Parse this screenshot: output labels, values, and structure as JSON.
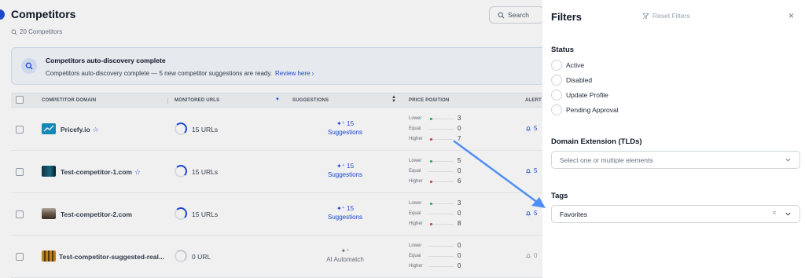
{
  "header": {
    "title": "Competitors",
    "count_text": "20 Competitors",
    "search_label": "Search"
  },
  "banner": {
    "title": "Competitors auto-discovery complete",
    "text": "Competitors auto-discovery complete — 5 new competitor suggestions are ready.",
    "link": "Review here ›"
  },
  "table": {
    "columns": [
      "COMPETITOR DOMAIN",
      "MONITORED URLS",
      "SUGGESTIONS",
      "PRICE POSITION",
      "ALERT"
    ],
    "price_labels": [
      "Lower",
      "Equal",
      "Higher"
    ],
    "rows": [
      {
        "domain": "Pricefy.io",
        "star": "☆",
        "urls": "15 URLs",
        "sugg_count": "15",
        "sugg_label": "Suggestions",
        "lower": "3",
        "equal": "0",
        "higher": "7",
        "alert": "5"
      },
      {
        "domain": "Test-competitor-1.com",
        "star": "☆",
        "urls": "15 URLs",
        "sugg_count": "15",
        "sugg_label": "Suggestions",
        "lower": "5",
        "equal": "0",
        "higher": "6",
        "alert": "5"
      },
      {
        "domain": "Test-competitor-2.com",
        "star": "",
        "urls": "15 URLs",
        "sugg_count": "15",
        "sugg_label": "Suggestions",
        "lower": "3",
        "equal": "0",
        "higher": "8",
        "alert": "5"
      },
      {
        "domain": "Test-competitor-suggested-real...",
        "star": "",
        "urls": "0 URL",
        "sugg_count": "",
        "sugg_label": "AI Automatch",
        "lower": "0",
        "equal": "0",
        "higher": "0",
        "alert": "0"
      }
    ]
  },
  "filters": {
    "title": "Filters",
    "reset_label": "Reset Filters",
    "close": "×",
    "status": {
      "title": "Status",
      "options": [
        "Active",
        "Disabled",
        "Update Profile",
        "Pending Approval"
      ]
    },
    "domain_ext": {
      "title": "Domain Extension (TLDs)",
      "placeholder": "Select one or multiple elements"
    },
    "tags": {
      "title": "Tags",
      "value": "Favorites",
      "clear": "×"
    }
  },
  "colors": {
    "accent": "#1d4ed8",
    "arrow": "#4f8ef7",
    "lower": "#22c55e",
    "higher": "#ef4444"
  },
  "icons": [
    "search-icon",
    "magnifier-count-icon",
    "discovery-icon",
    "sparkle-icon",
    "bell-icon",
    "filter-reset-icon",
    "close-icon",
    "chevron-down-icon",
    "star-icon"
  ]
}
